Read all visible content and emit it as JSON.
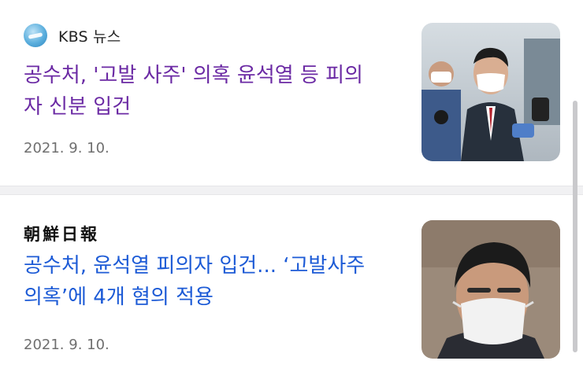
{
  "articles": [
    {
      "source": "KBS 뉴스",
      "headline_line1": "공수처, '고발 사주' 의혹 윤석열 등 피의",
      "headline_line2": "자 신분 입건",
      "date": "2021. 9. 10.",
      "thumbnail": "photo-press-scrum-masked-man",
      "headline_color": "#6b2aa4"
    },
    {
      "source": "朝鮮日報",
      "headline_line1": "공수처, 윤석열 피의자 입건... ‘고발사주",
      "headline_line2": "의혹’에 4개 혐의 적용",
      "date": "2021. 9. 10.",
      "thumbnail": "photo-masked-man-portrait",
      "headline_color": "#1d5bd6"
    }
  ]
}
